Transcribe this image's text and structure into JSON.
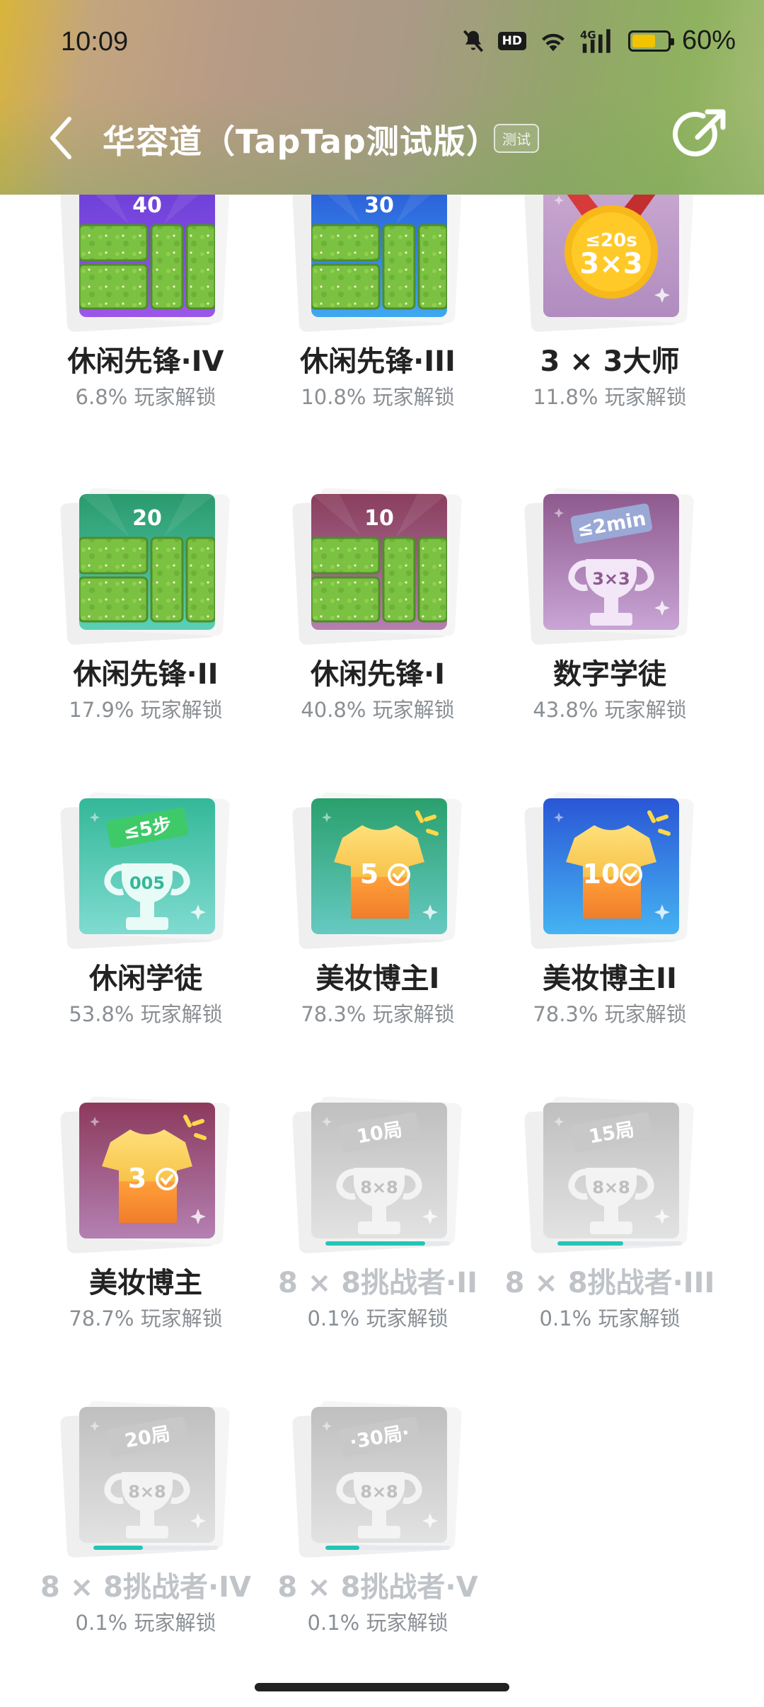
{
  "status_bar": {
    "time": "10:09",
    "battery_text": "60%",
    "hd_label": "HD",
    "icons": [
      "bell-off-icon",
      "hd-icon",
      "wifi-icon",
      "4g-signal-icon",
      "battery-icon"
    ]
  },
  "nav": {
    "title": "华容道（TapTap测试版）",
    "tag": "测试",
    "back_icon": "back-arrow-icon",
    "share_icon": "share-icon"
  },
  "achievements": [
    {
      "name": "休闲先锋·IV",
      "unlock": "6.8% 玩家解锁",
      "badge_text": "40",
      "theme": "purple",
      "locked": false
    },
    {
      "name": "休闲先锋·III",
      "unlock": "10.8% 玩家解锁",
      "badge_text": "30",
      "theme": "blue",
      "locked": false
    },
    {
      "name": "3 × 3大师",
      "unlock": "11.8% 玩家解锁",
      "badge_text": "≤20s",
      "badge_sub": "3×3",
      "theme": "medal",
      "locked": false
    },
    {
      "name": "休闲先锋·II",
      "unlock": "17.9% 玩家解锁",
      "badge_text": "20",
      "theme": "green",
      "locked": false
    },
    {
      "name": "休闲先锋·I",
      "unlock": "40.8% 玩家解锁",
      "badge_text": "10",
      "theme": "maroon",
      "locked": false
    },
    {
      "name": "数字学徒",
      "unlock": "43.8% 玩家解锁",
      "badge_text": "≤2min",
      "badge_sub": "3×3",
      "theme": "trophy-purple",
      "locked": false
    },
    {
      "name": "休闲学徒",
      "unlock": "53.8% 玩家解锁",
      "badge_text": "≤5步",
      "badge_sub": "005",
      "theme": "trophy-teal",
      "locked": false
    },
    {
      "name": "美妆博主I",
      "unlock": "78.3% 玩家解锁",
      "badge_text": "5",
      "theme": "shirt-green",
      "locked": false
    },
    {
      "name": "美妆博主II",
      "unlock": "78.3% 玩家解锁",
      "badge_text": "10",
      "theme": "shirt-blue",
      "locked": false
    },
    {
      "name": "美妆博主",
      "unlock": "78.7% 玩家解锁",
      "badge_text": "3",
      "theme": "shirt-maroon",
      "locked": false
    },
    {
      "name": "8 × 8挑战者·II",
      "unlock": "0.1% 玩家解锁",
      "badge_text": "10局",
      "badge_sub": "8×8",
      "theme": "trophy-gray",
      "locked": true,
      "progress": 0.8
    },
    {
      "name": "8 × 8挑战者·III",
      "unlock": "0.1% 玩家解锁",
      "badge_text": "15局",
      "badge_sub": "8×8",
      "theme": "trophy-gray",
      "locked": true,
      "progress": 0.53
    },
    {
      "name": "8 × 8挑战者·IV",
      "unlock": "0.1% 玩家解锁",
      "badge_text": "20局",
      "badge_sub": "8×8",
      "theme": "trophy-gray",
      "locked": true,
      "progress": 0.4
    },
    {
      "name": "8 × 8挑战者·V",
      "unlock": "0.1% 玩家解锁",
      "badge_text": "·30局·",
      "badge_sub": "8×8",
      "theme": "trophy-gray",
      "locked": true,
      "progress": 0.27
    }
  ]
}
